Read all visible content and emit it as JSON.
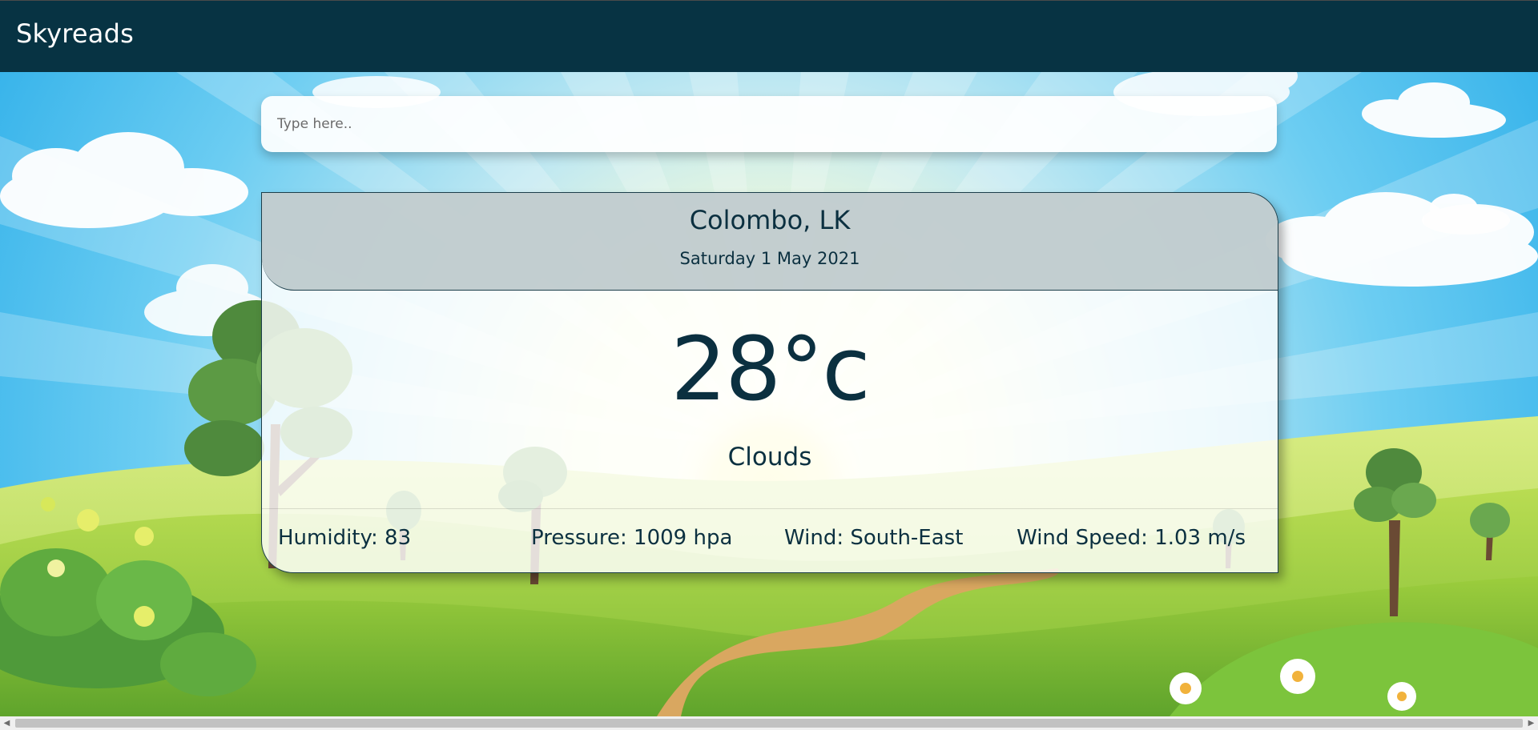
{
  "app": {
    "brand": "Skyreads"
  },
  "search": {
    "placeholder": "Type here..",
    "value": ""
  },
  "weather": {
    "location": "Colombo, LK",
    "date": "Saturday 1 May 2021",
    "temperature": "28°c",
    "condition": "Clouds",
    "stats": {
      "humidity": "Humidity: 83",
      "pressure": "Pressure: 1009 hpa",
      "wind": "Wind: South-East",
      "wind_speed": "Wind Speed: 1.03 m/s"
    }
  },
  "icons": {
    "scroll_left": "scroll-left-arrow-icon",
    "scroll_right": "scroll-right-arrow-icon"
  },
  "colors": {
    "header_bg": "#073343",
    "text_dark": "#0b3040",
    "sky": "#5ec3ef",
    "grass": "#8bc43e"
  }
}
